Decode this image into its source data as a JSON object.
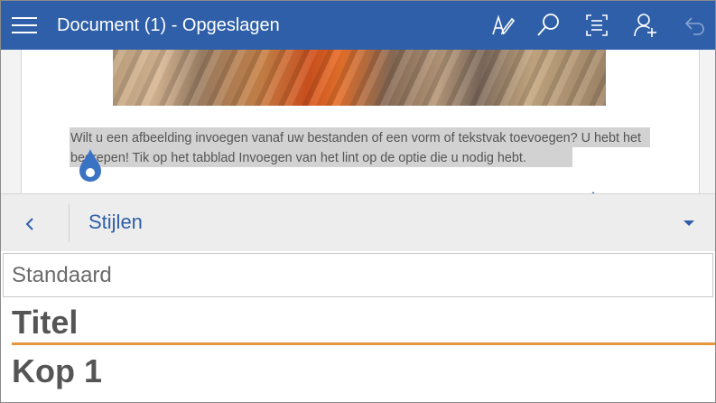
{
  "titlebar": {
    "title": "Document (1) - Opgeslagen",
    "icons": [
      "menu-icon",
      "draw-pen-icon",
      "search-icon",
      "focus-read-icon",
      "share-person-icon",
      "undo-icon"
    ]
  },
  "document": {
    "paragraph": "Wilt u een afbeelding invoegen vanaf uw bestanden of een vorm of tekstvak toevoegen? U hebt het begrepen! Tik op het tabblad Invoegen van het lint op de optie die u nodig hebt."
  },
  "styles_pane": {
    "title": "Stijlen",
    "items": [
      "Standaard",
      "Titel",
      "Kop 1"
    ]
  },
  "colors": {
    "accent": "#2f5fa8",
    "title_underline": "#e8963c",
    "selection": "#d2d2d2"
  }
}
